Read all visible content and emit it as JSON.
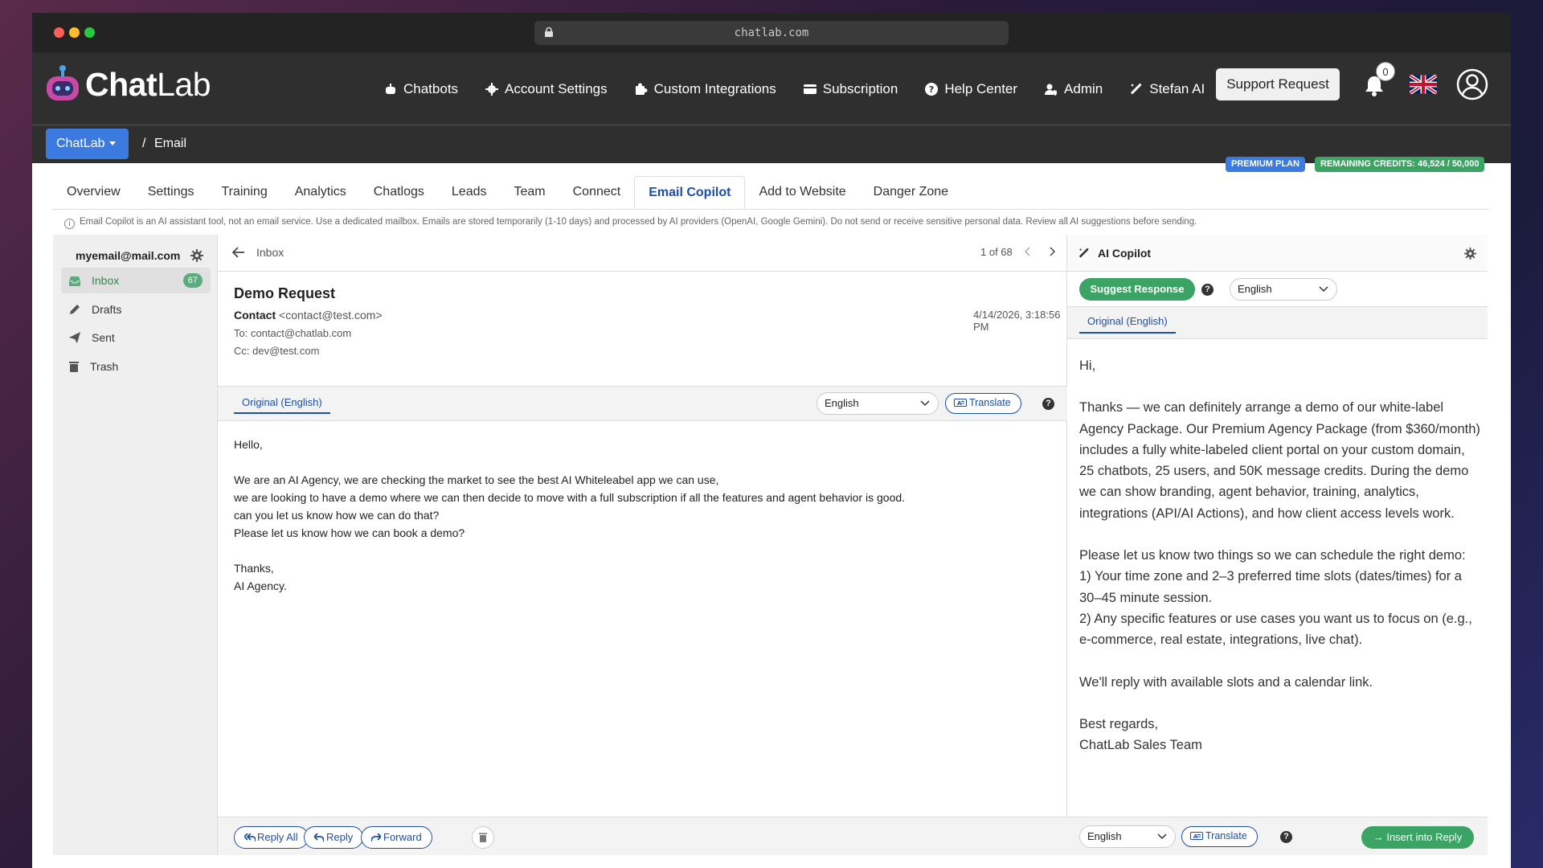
{
  "browser": {
    "url": "chatlab.com"
  },
  "brand": {
    "name_bold": "Chat",
    "name_light": "Lab"
  },
  "nav": {
    "items": [
      {
        "label": "Chatbots",
        "icon": "robot-icon"
      },
      {
        "label": "Account Settings",
        "icon": "gear-icon"
      },
      {
        "label": "Custom Integrations",
        "icon": "puzzle-icon"
      },
      {
        "label": "Subscription",
        "icon": "credit-card-icon"
      },
      {
        "label": "Help Center",
        "icon": "question-circle-icon"
      },
      {
        "label": "Admin",
        "icon": "user-shield-icon"
      },
      {
        "label": "Stefan AI",
        "icon": "magic-wand-icon"
      }
    ],
    "support_label": "Support Request",
    "notification_count": "0"
  },
  "breadcrumb": {
    "root": "ChatLab",
    "separator": "/",
    "current": "Email"
  },
  "plan": {
    "plan_label": "PREMIUM PLAN",
    "credits_label": "REMAINING CREDITS: 46,524 / 50,000"
  },
  "tabs": [
    "Overview",
    "Settings",
    "Training",
    "Analytics",
    "Chatlogs",
    "Leads",
    "Team",
    "Connect",
    "Email Copilot",
    "Add to Website",
    "Danger Zone"
  ],
  "active_tab": "Email Copilot",
  "notice": "Email Copilot is an AI assistant tool, not an email service. Use a dedicated mailbox. Emails are stored temporarily (1-10 days) and processed by AI providers (OpenAI, Google Gemini). Do not send or receive sensitive personal data. Review all AI suggestions before sending.",
  "sidebar": {
    "account": "myemail@mail.com",
    "folders": [
      {
        "label": "Inbox",
        "count": "67"
      },
      {
        "label": "Drafts"
      },
      {
        "label": "Sent"
      },
      {
        "label": "Trash"
      }
    ]
  },
  "mail": {
    "back_label": "Inbox",
    "pager": "1 of 68",
    "subject": "Demo Request",
    "from_name": "Contact",
    "from_email": "<contact@test.com>",
    "to": "To: contact@chatlab.com",
    "cc": "Cc: dev@test.com",
    "date": "4/14/2026, 3:18:56 PM",
    "original_tab": "Original (English)",
    "language": "English",
    "translate_label": "Translate",
    "body": "Hello,\n\nWe are an AI Agency, we are checking the market to see the best AI Whiteleabel app we can use,\nwe are looking to have a demo where we can then decide to move with a full subscription if all the features and agent behavior is good.\ncan you let us know how we can do that?\nPlease let us know how we can book a demo?\n\nThanks,\nAI Agency.",
    "actions": {
      "reply_all": "Reply All",
      "reply": "Reply",
      "forward": "Forward"
    }
  },
  "copilot": {
    "title": "AI Copilot",
    "suggest_label": "Suggest Response",
    "language": "English",
    "original_tab": "Original (English)",
    "response": [
      "Hi,",
      "",
      "Thanks — we can definitely arrange a demo of our white-label Agency Package. Our Premium Agency Package (from $360/month) includes a fully white-labeled client portal on your custom domain, 25 chatbots, 25 users, and 50K message credits. During the demo we can show branding, agent behavior, training, analytics, integrations (API/AI Actions), and how client access levels work.",
      "",
      "Please let us know two things so we can schedule the right demo:",
      "1) Your time zone and 2–3 preferred time slots (dates/times) for a 30–45 minute session.",
      "2) Any specific features or use cases you want us to focus on (e.g., e-commerce, real estate, integrations, live chat).",
      "",
      "We'll reply with available slots and a calendar link.",
      "",
      "Best regards,",
      "ChatLab Sales Team"
    ],
    "footer_language": "English",
    "translate_label": "Translate",
    "insert_label": "→ Insert into Reply"
  },
  "colors": {
    "accent": "#3b7be0",
    "link": "#1e4fa8",
    "success": "#3ba364",
    "nav_bg": "#2f2f2f"
  }
}
